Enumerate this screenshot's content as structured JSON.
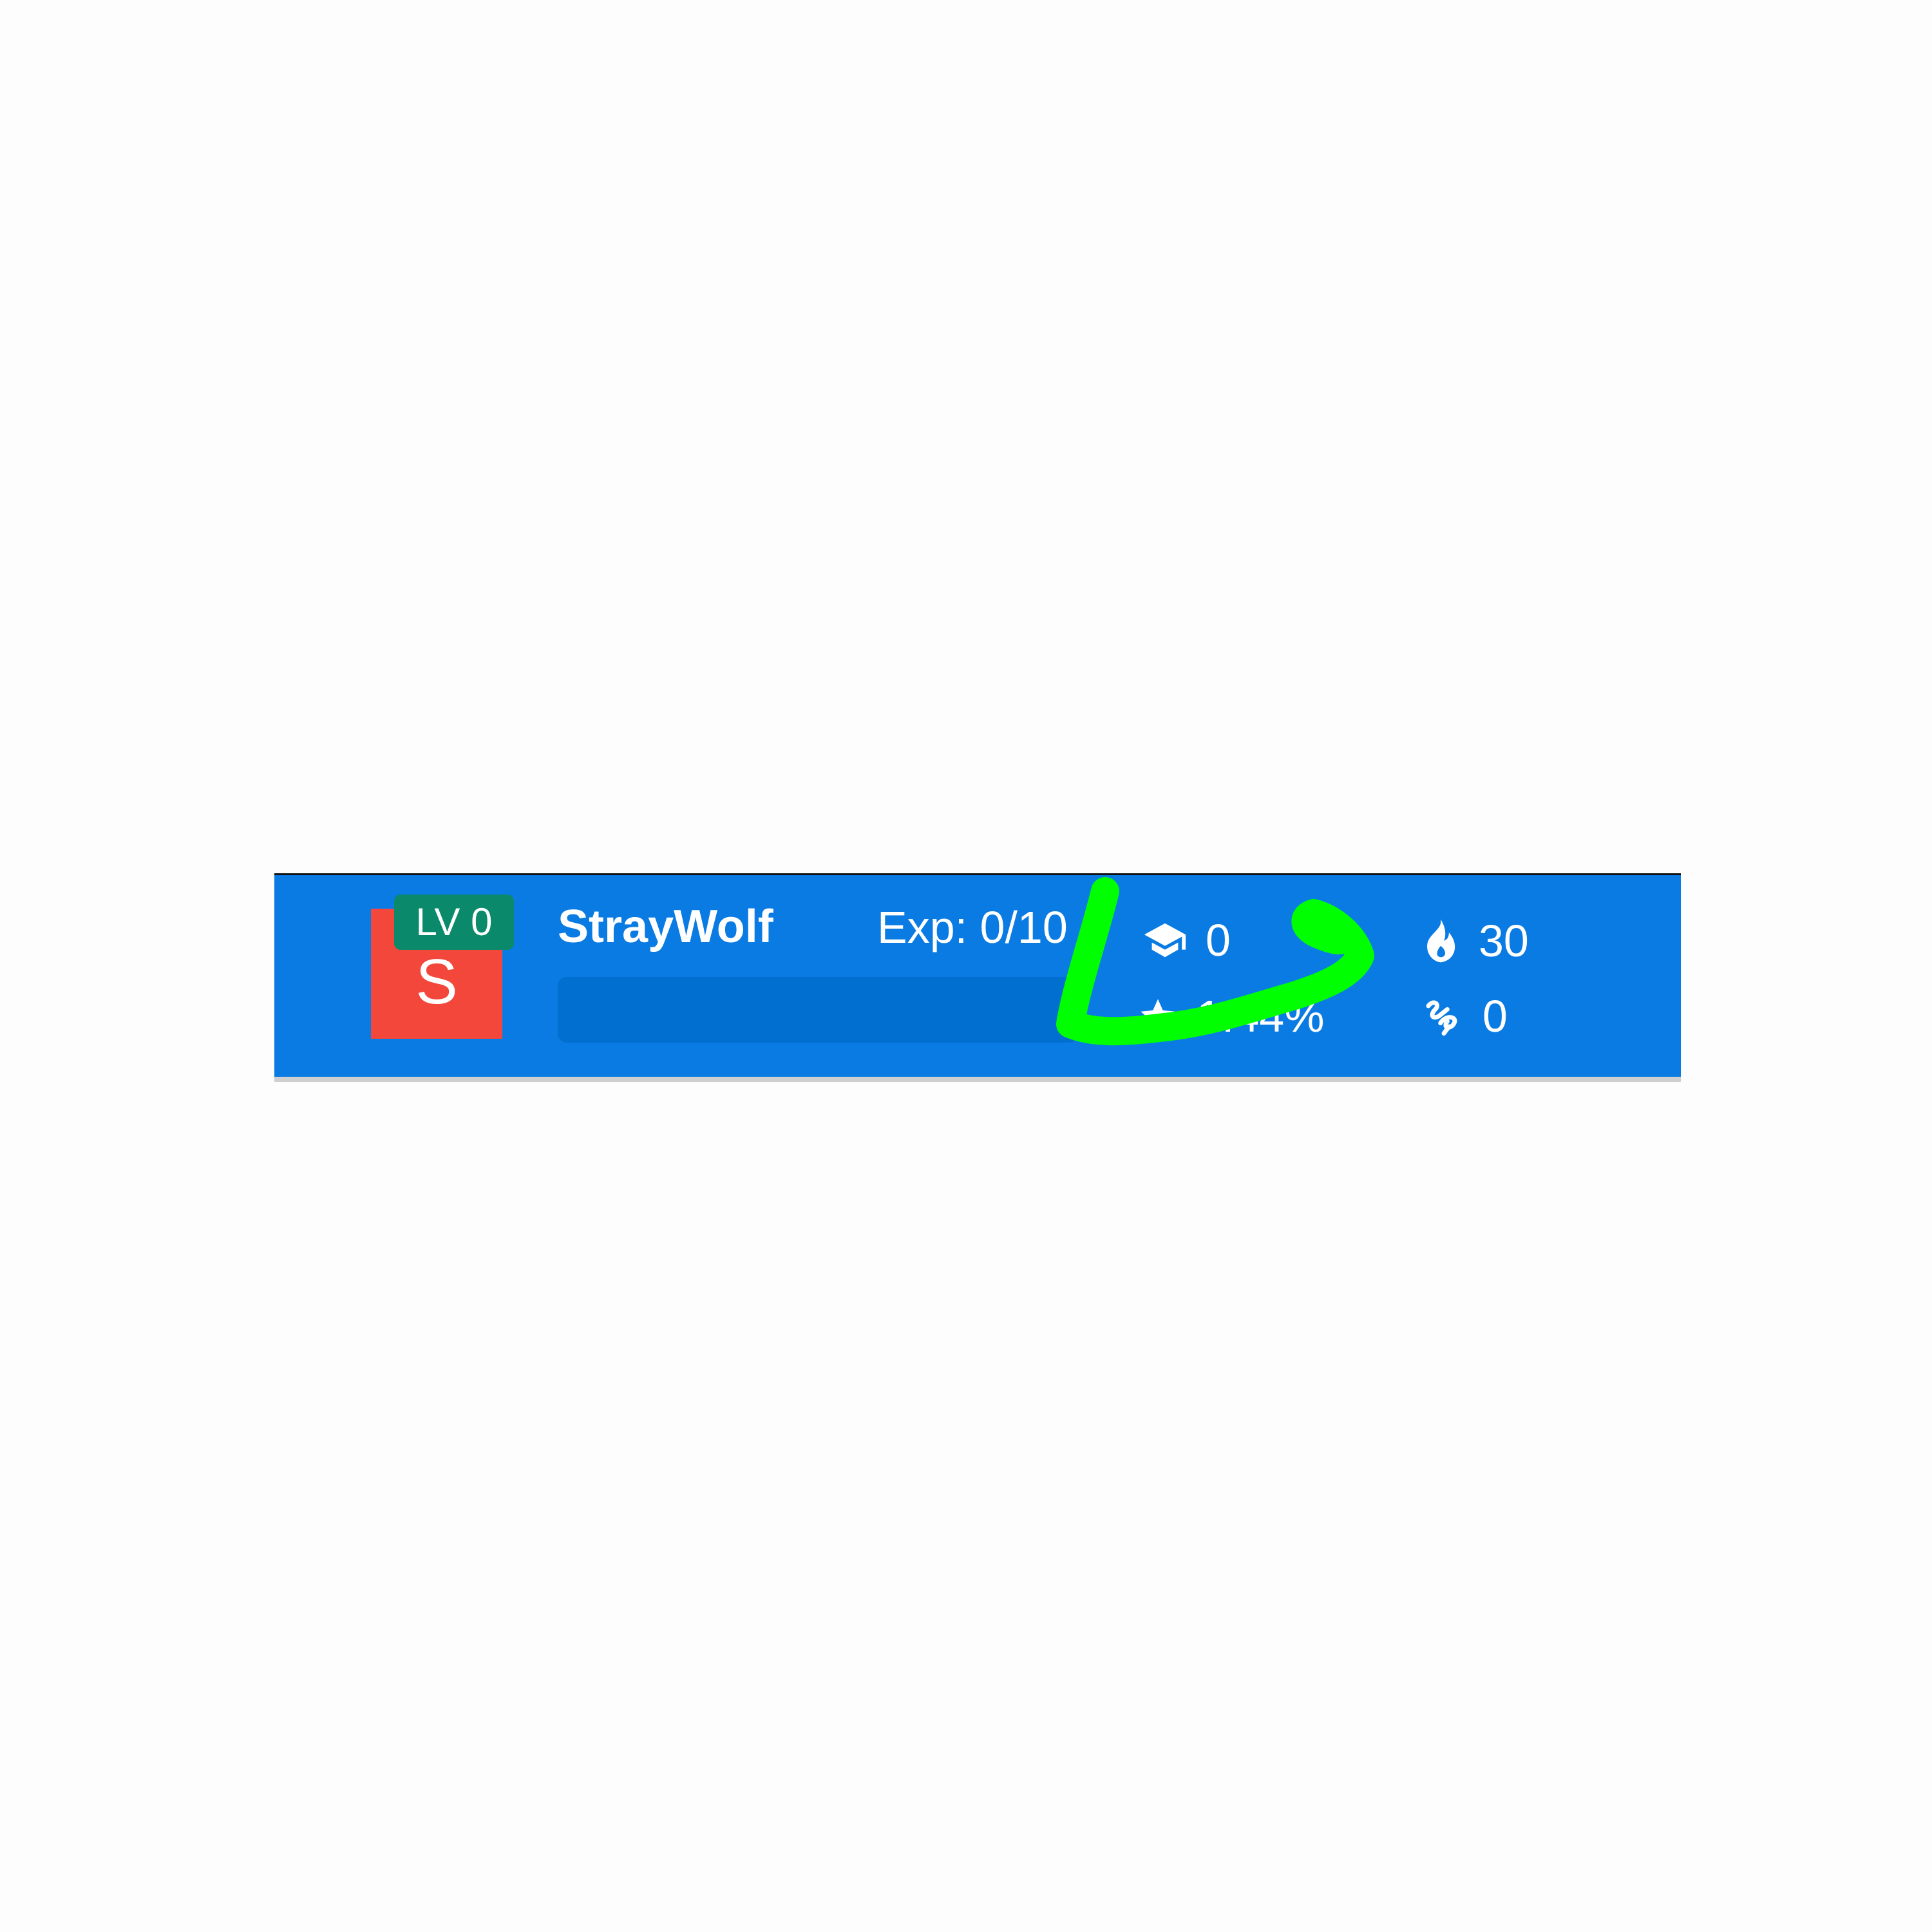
{
  "profile": {
    "avatar_letter": "S",
    "level_label": "LV 0",
    "username": "StrayWolf",
    "exp_label": "Exp: 0/10",
    "exp_progress_fraction": 0
  },
  "stats": {
    "courses": {
      "icon": "graduation-cap-icon",
      "value": "0"
    },
    "rate": {
      "icon": "star-icon",
      "value": "1.44%"
    },
    "streak": {
      "icon": "fire-icon",
      "value": "30"
    },
    "coins": {
      "icon": "coin-swirl-icon",
      "value": "0"
    }
  },
  "colors": {
    "bar": "#0a7be3",
    "avatar": "#f2473a",
    "level_badge": "#0a8a6b",
    "exp_track": "#006fcf",
    "annotation": "#00ff00"
  },
  "annotation": {
    "type": "hand-drawn-arrow"
  }
}
